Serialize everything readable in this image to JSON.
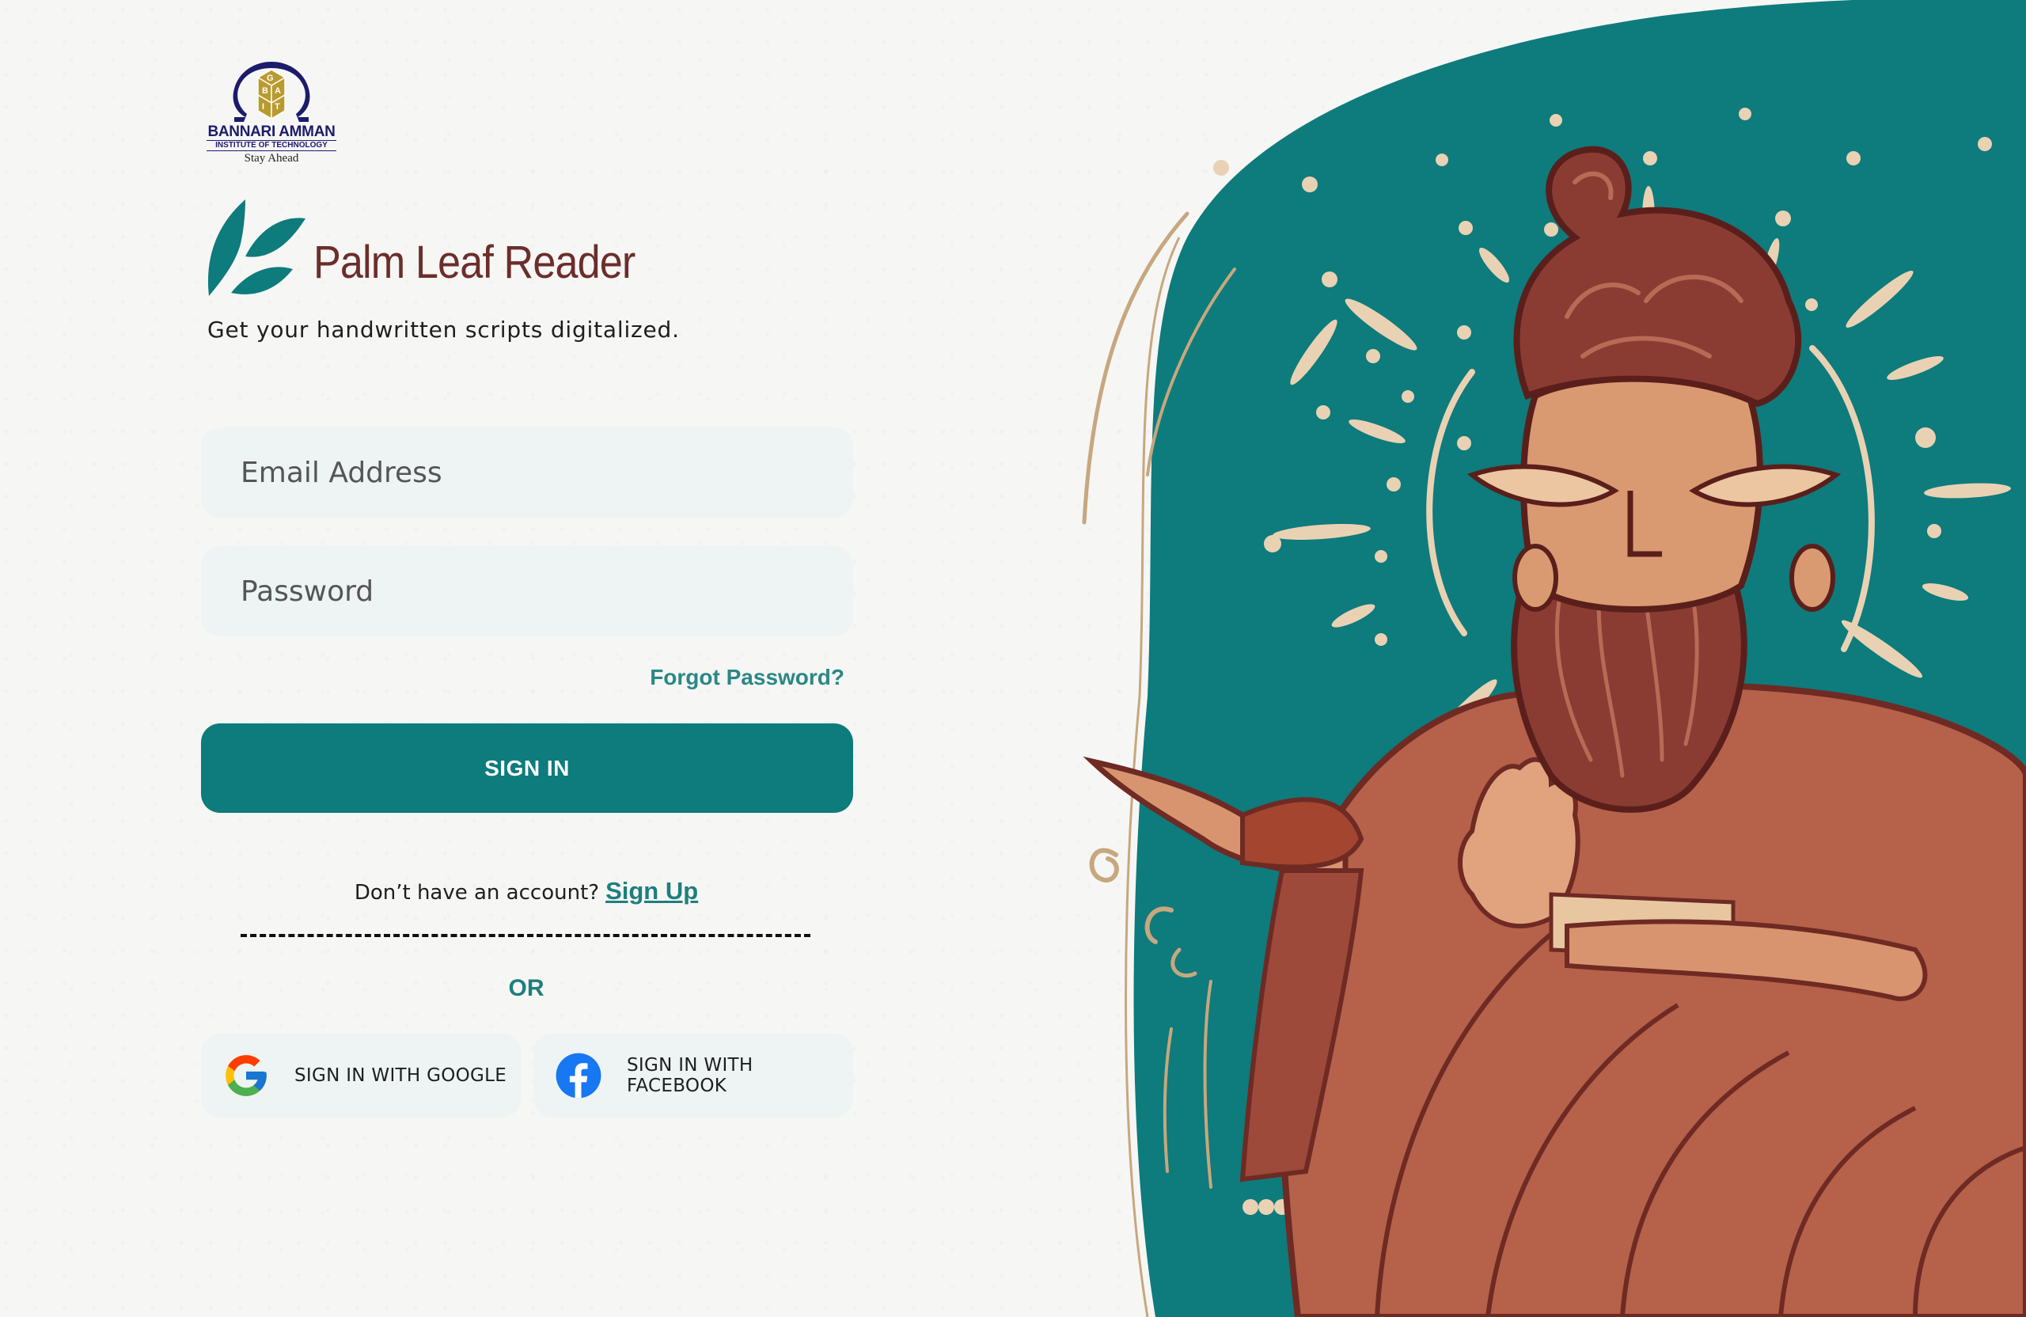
{
  "institute": {
    "name": "BANNARI AMMAN",
    "subtitle": "INSTITUTE OF TECHNOLOGY",
    "tagline": "Stay Ahead"
  },
  "brand": {
    "name": "Palm Leaf Reader",
    "tagline": "Get your handwritten scripts digitalized.",
    "logo_icon": "palm-leaf-icon",
    "name_color": "#6b2e2b",
    "leaf_color": "#0e7b7c"
  },
  "form": {
    "email_placeholder": "Email Address",
    "password_placeholder": "Password",
    "forgot_label": "Forgot Password?",
    "signin_label": "SIGN IN",
    "signup_prompt": "Don’t have an account?",
    "signup_link": "Sign Up",
    "or_label": "OR",
    "google_label": "SIGN IN WITH GOOGLE",
    "facebook_label": "SIGN IN WITH FACEBOOK",
    "accent_color": "#0e7b7c"
  },
  "illustration": {
    "subject": "sage-illustration",
    "background_color": "#0e7b7c"
  }
}
